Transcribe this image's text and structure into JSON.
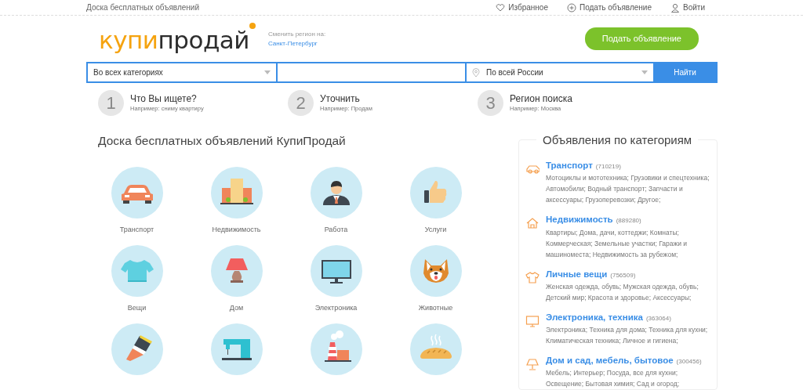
{
  "topbar": {
    "site_title": "Доска бесплатных объявлений",
    "links": [
      {
        "kind": "heart",
        "label": "Избранное"
      },
      {
        "kind": "plus",
        "label": "Подать объявление"
      },
      {
        "kind": "user",
        "label": "Войти"
      }
    ]
  },
  "header": {
    "logo": {
      "part_1": "купи",
      "part_2": "продай"
    },
    "region_label": "Сменить регион на:",
    "region_link": "Санкт-Петербург",
    "post_button": "Подать объявление"
  },
  "search": {
    "category": "Во всех категориях",
    "region": "По всей России",
    "button": "Найти"
  },
  "steps": [
    {
      "number": "1",
      "title": "Что Вы ищете?",
      "hint": "Например: сниму квартиру"
    },
    {
      "number": "2",
      "title": "Уточнить",
      "hint": "Например: Продам"
    },
    {
      "number": "3",
      "title": "Регион поиска",
      "hint": "Например: Москва"
    }
  ],
  "main": {
    "heading": "Доска бесплатных объявлений КупиПродай",
    "tiles": [
      {
        "kind": "car",
        "label": "Транспорт"
      },
      {
        "kind": "buildings",
        "label": "Недвижимость"
      },
      {
        "kind": "businessman",
        "label": "Работа"
      },
      {
        "kind": "thumb",
        "label": "Услуги"
      },
      {
        "kind": "shirt",
        "label": "Вещи"
      },
      {
        "kind": "lamp",
        "label": "Дом"
      },
      {
        "kind": "monitor",
        "label": "Электроника"
      },
      {
        "kind": "dog",
        "label": "Животные"
      },
      {
        "kind": "brush"
      },
      {
        "kind": "sewing"
      },
      {
        "kind": "factory"
      },
      {
        "kind": "bread"
      }
    ]
  },
  "sidebar": {
    "title": "Объявления по категориям",
    "categories": [
      {
        "kind": "car",
        "name": "Транспорт",
        "count": "(710219)",
        "subcategories": "Мотоциклы и мототехника; Грузовики и спецтехника; Автомобили; Водный транспорт; Запчасти и аксессуары; Грузоперевозки; Другое;"
      },
      {
        "kind": "house",
        "name": "Недвижимость",
        "count": "(889280)",
        "subcategories": "Квартиры; Дома, дачи, коттеджи; Комнаты; Коммерческая; Земельные участки; Гаражи и машиноместа; Недвижимость за рубежом;"
      },
      {
        "kind": "shirt",
        "name": "Личные вещи",
        "count": "(756509)",
        "subcategories": "Женская одежда, обувь; Мужская одежда, обувь; Детский мир; Красота и здоровье; Аксессуары;"
      },
      {
        "kind": "monitor",
        "name": "Электроника, техника",
        "count": "(363064)",
        "subcategories": "Электроника; Техника для дома; Техника для кухни; Климатическая техника; Личное и гигиена;"
      },
      {
        "kind": "lamp",
        "name": "Дом и сад, мебель, бытовое",
        "count": "(300456)",
        "subcategories": "Мебель; Интерьер; Посуда, все для кухни; Освещение; Бытовая химия; Сад и огород;"
      }
    ]
  }
}
